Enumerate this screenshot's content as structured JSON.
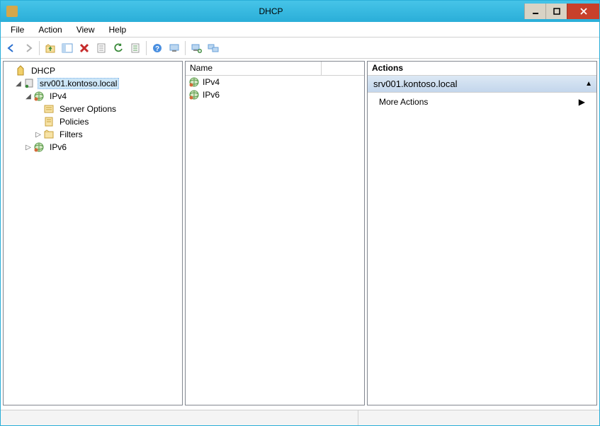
{
  "window": {
    "title": "DHCP"
  },
  "menubar": [
    "File",
    "Action",
    "View",
    "Help"
  ],
  "tree": {
    "root": "DHCP",
    "server": "srv001.kontoso.local",
    "ipv4": "IPv4",
    "ipv4_children": [
      "Server Options",
      "Policies",
      "Filters"
    ],
    "ipv6": "IPv6"
  },
  "list": {
    "header": "Name",
    "rows": [
      "IPv4",
      "IPv6"
    ]
  },
  "actions": {
    "header": "Actions",
    "context": "srv001.kontoso.local",
    "more": "More Actions"
  }
}
